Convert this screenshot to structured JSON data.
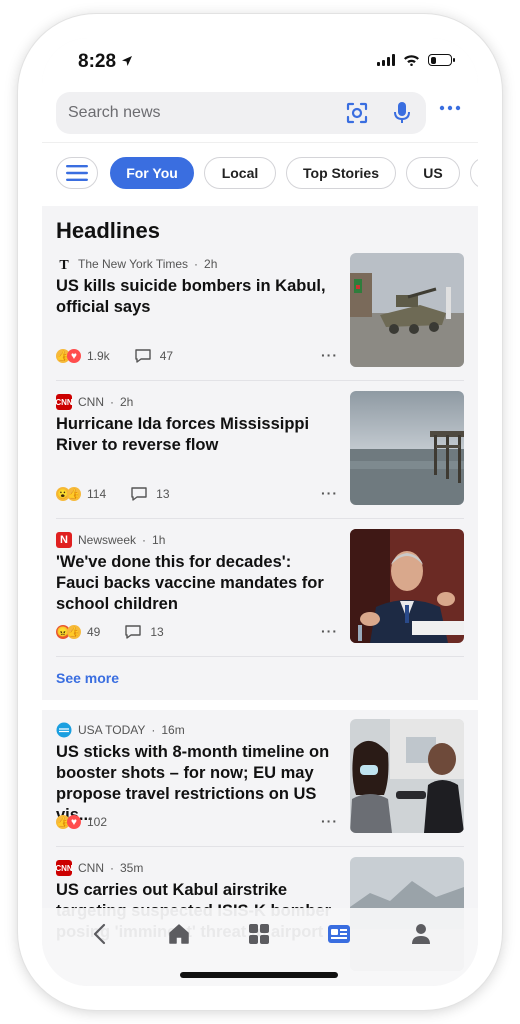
{
  "status_bar": {
    "time": "8:28",
    "location_icon": "location-arrow-icon",
    "battery_level": 0.3
  },
  "search": {
    "placeholder": "Search news"
  },
  "tabs": [
    {
      "label": "For You",
      "active": true
    },
    {
      "label": "Local",
      "active": false
    },
    {
      "label": "Top Stories",
      "active": false
    },
    {
      "label": "US",
      "active": false
    }
  ],
  "headlines": {
    "title": "Headlines",
    "see_more": "See more",
    "articles": [
      {
        "source": "The New York Times",
        "time": "2h",
        "title": "US kills suicide bombers in Kabul, official says",
        "reactions": [
          "thumbs-up",
          "heart"
        ],
        "reaction_count": "1.9k",
        "comment_count": "47"
      },
      {
        "source": "CNN",
        "time": "2h",
        "title": "Hurricane Ida forces Mississippi River to reverse flow",
        "reactions": [
          "surprised",
          "thumbs-up"
        ],
        "reaction_count": "114",
        "comment_count": "13"
      },
      {
        "source": "Newsweek",
        "time": "1h",
        "title": "'We've done this for decades': Fauci backs vaccine mandates for school children",
        "reactions": [
          "angry",
          "thumbs-up"
        ],
        "reaction_count": "49",
        "comment_count": "13"
      }
    ]
  },
  "feed": [
    {
      "source": "USA TODAY",
      "time": "16m",
      "title": "US sticks with 8-month timeline on booster shots – for now; EU may propose travel restrictions on US vis...",
      "reactions": [
        "thumbs-up",
        "heart"
      ],
      "reaction_count": "102"
    },
    {
      "source": "CNN",
      "time": "35m",
      "title": "US carries out Kabul airstrike targeting suspected ISIS-K bomber posing 'imminent' threat to airport"
    }
  ],
  "bottom_nav": [
    {
      "icon": "back-chevron-icon",
      "active": false
    },
    {
      "icon": "home-icon",
      "active": false
    },
    {
      "icon": "grid-icon",
      "active": false
    },
    {
      "icon": "news-icon",
      "active": true
    },
    {
      "icon": "profile-icon",
      "active": false
    }
  ],
  "colors": {
    "accent": "#3a6ee0",
    "text": "#111111",
    "background": "#f4f4f6"
  }
}
